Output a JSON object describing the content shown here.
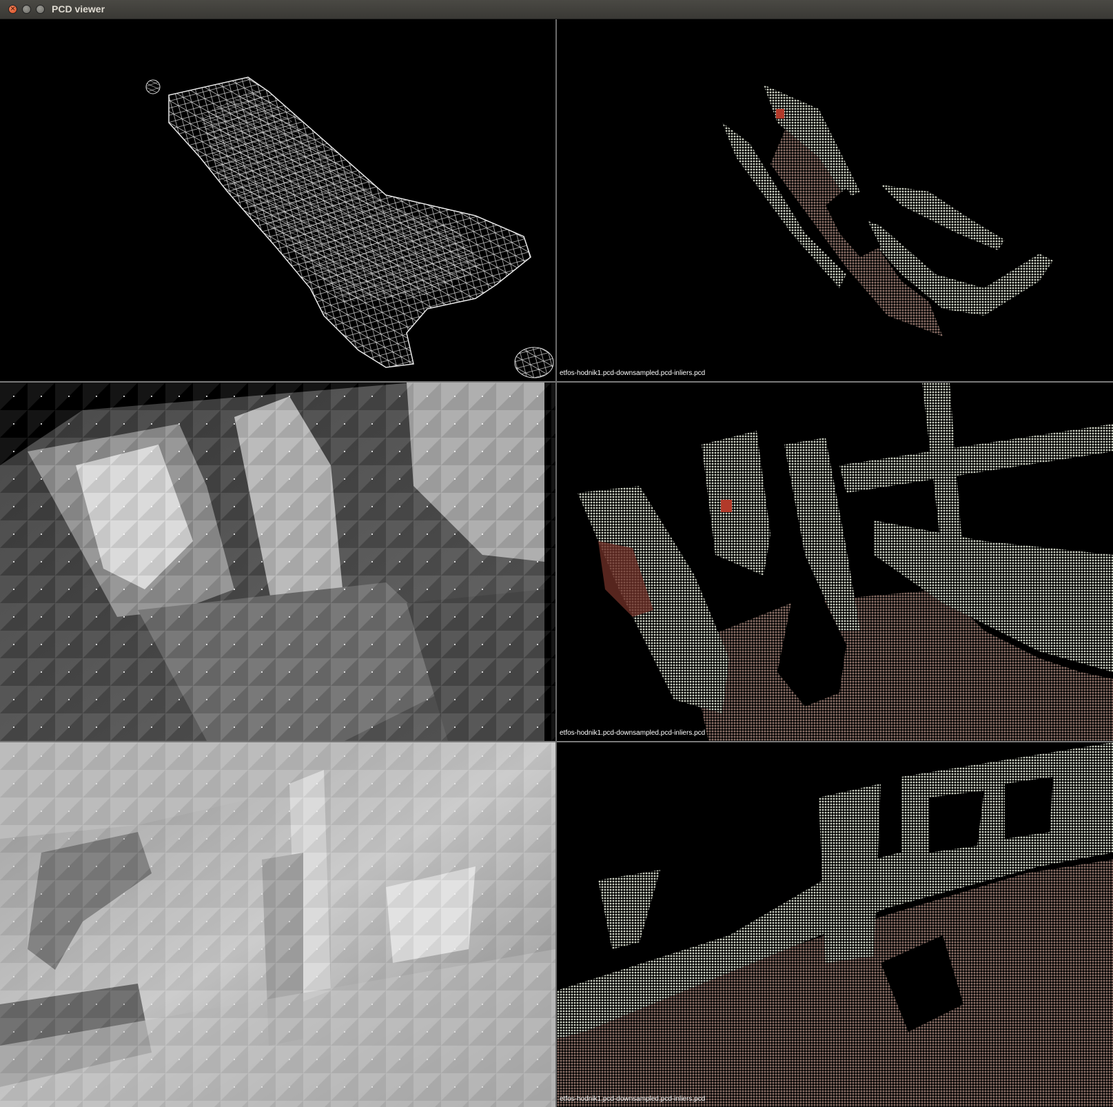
{
  "window": {
    "title": "PCD viewer"
  },
  "viewports": {
    "top_right_label": "etfos-hodnik1.pcd-downsampled.pcd-inliers.pcd",
    "middle_right_label": "etfos-hodnik1.pcd-downsampled.pcd-inliers.pcd",
    "bottom_right_label": "etfos-hodnik1.pcd-downsampled.pcd-inliers.pcd"
  },
  "colors": {
    "background": "#000000",
    "mesh": "#e0e0e0",
    "floor": "#8a6f66",
    "wall": "#b8bdb0"
  }
}
